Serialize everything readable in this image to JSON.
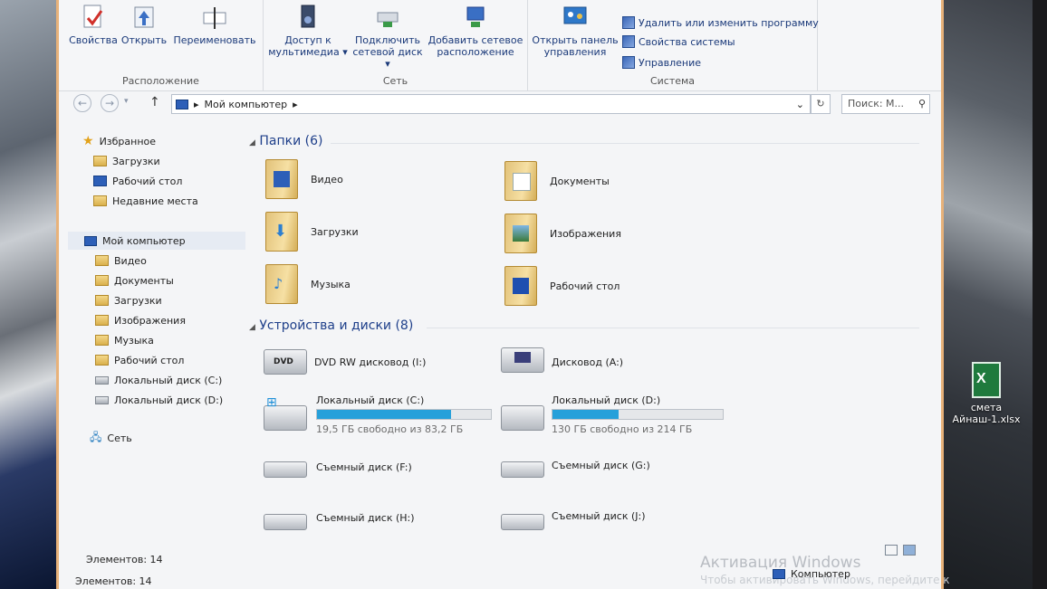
{
  "ribbon": {
    "groups": [
      {
        "title": "Расположение",
        "buttons": [
          "Свойства",
          "Открыть",
          "Переименовать"
        ]
      },
      {
        "title": "Сеть",
        "buttons": [
          "Доступ к мультимедиа",
          "Подключить сетевой диск",
          "Добавить сетевое расположение"
        ]
      },
      {
        "title": "Система",
        "buttons": [
          "Открыть панель управления"
        ],
        "small": [
          "Удалить или изменить программу",
          "Свойства системы",
          "Управление"
        ]
      }
    ],
    "media_l1": "Доступ к",
    "media_l2": "мультимедиа",
    "netdrive_l1": "Подключить",
    "netdrive_l2": "сетевой диск",
    "addnet_l1": "Добавить сетевое",
    "addnet_l2": "расположение",
    "cp_l1": "Открыть панель",
    "cp_l2": "управления"
  },
  "address": {
    "path": "Мой компьютер",
    "search_placeholder": "Поиск: М..."
  },
  "nav": {
    "favorites": "Избранное",
    "fav_items": [
      "Загрузки",
      "Рабочий стол",
      "Недавние места"
    ],
    "computer": "Мой компьютер",
    "computer_items": [
      "Видео",
      "Документы",
      "Загрузки",
      "Изображения",
      "Музыка",
      "Рабочий стол",
      "Локальный диск (C:)",
      "Локальный диск (D:)"
    ],
    "network": "Сеть"
  },
  "folders_header": "Папки (6)",
  "folders": [
    "Видео",
    "Документы",
    "Загрузки",
    "Изображения",
    "Музыка",
    "Рабочий стол"
  ],
  "devices_header": "Устройства и диски (8)",
  "devices": {
    "dvd": "DVD RW дисковод (I:)",
    "floppy": "Дисковод (A:)",
    "c_name": "Локальный диск (C:)",
    "c_free": "19,5 ГБ свободно из 83,2 ГБ",
    "c_used_fraction": 0.77,
    "d_name": "Локальный диск (D:)",
    "d_free": "130 ГБ свободно из 214 ГБ",
    "d_used_fraction": 0.39,
    "f": "Съемный диск (F:)",
    "g": "Съемный диск (G:)",
    "h": "Съемный диск (H:)",
    "j": "Съемный диск (J:)"
  },
  "status": {
    "items_inner": "Элементов: 14",
    "items_outer": "Элементов: 14",
    "computer": "Компьютер"
  },
  "watermark": {
    "title": "Активация Windows",
    "subtitle": "Чтобы активировать Windows, перейдите к"
  },
  "desktop": {
    "file_label": "смета Айнаш-1.xlsx"
  },
  "colors": {
    "accent": "#1e3f8a",
    "bar_fill": "#26a0da",
    "window_border": "#e8b27a"
  }
}
